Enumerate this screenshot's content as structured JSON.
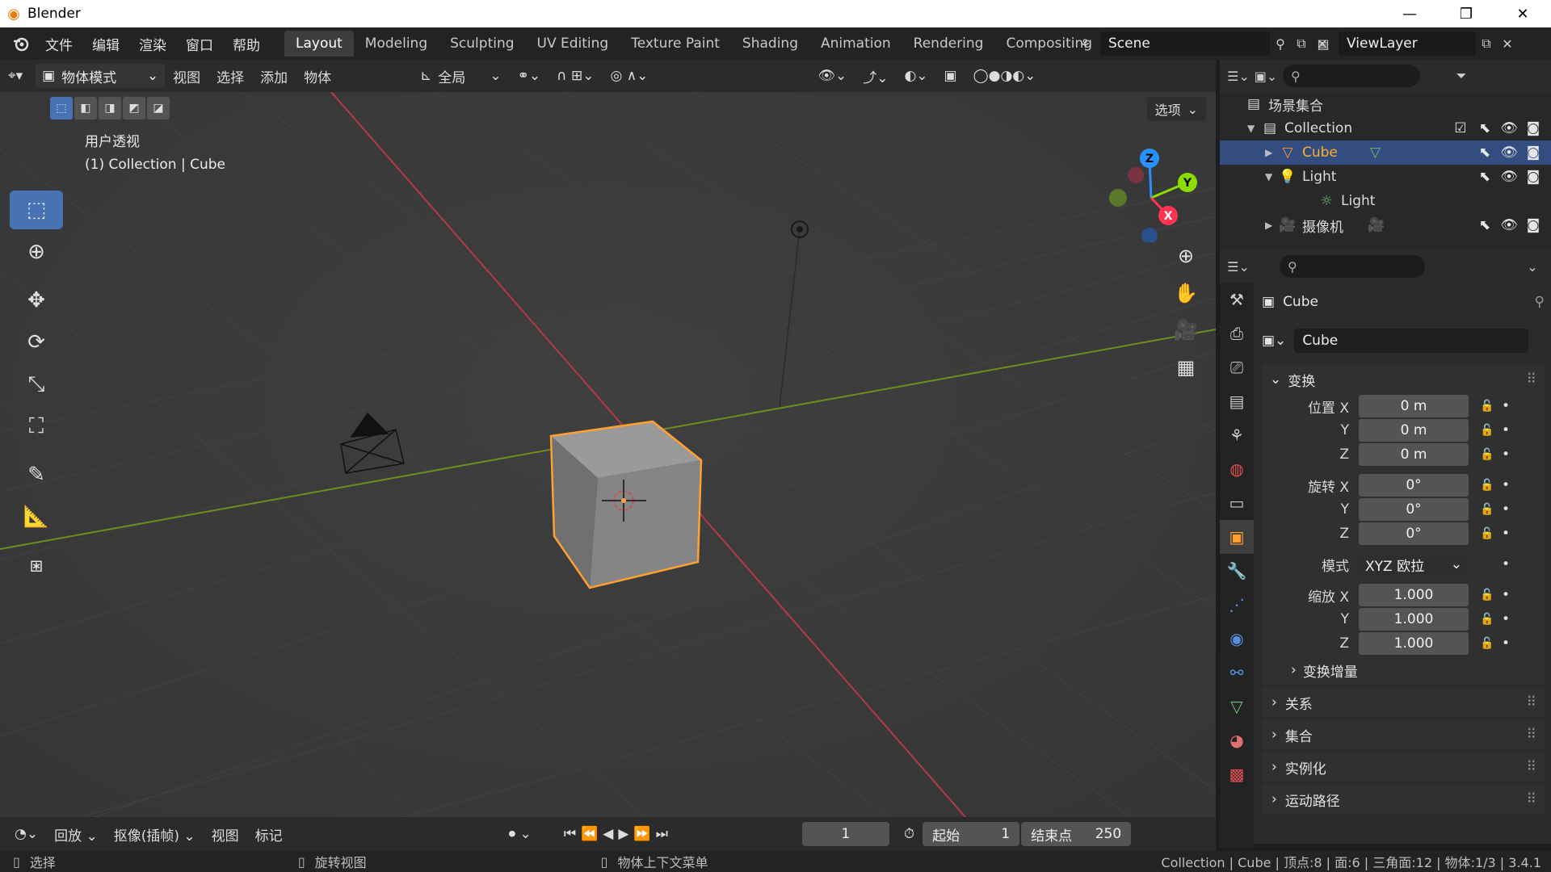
{
  "window": {
    "title": "Blender",
    "minimize": "—",
    "maximize": "❐",
    "close": "✕"
  },
  "menu": [
    "文件",
    "编辑",
    "渲染",
    "窗口",
    "帮助"
  ],
  "workspaces": [
    "Layout",
    "Modeling",
    "Sculpting",
    "UV Editing",
    "Texture Paint",
    "Shading",
    "Animation",
    "Rendering",
    "Compositing"
  ],
  "active_workspace": "Layout",
  "scene": {
    "name": "Scene",
    "view_layer": "ViewLayer"
  },
  "viewport": {
    "mode": "物体模式",
    "header_menus": [
      "视图",
      "选择",
      "添加",
      "物体"
    ],
    "transform_orientation": "全局",
    "options_label": "选项",
    "view_name": "用户透视",
    "collection_info": "(1) Collection | Cube",
    "gizmo": {
      "z": "Z",
      "y": "Y",
      "x": "X"
    }
  },
  "outliner": {
    "root": "场景集合",
    "rows": [
      {
        "label": "Collection",
        "depth": 1
      },
      {
        "label": "Cube",
        "depth": 2,
        "selected": true
      },
      {
        "label": "Light",
        "depth": 2
      },
      {
        "label": "Light",
        "depth": 3
      },
      {
        "label": "摄像机",
        "depth": 2
      }
    ]
  },
  "properties": {
    "object_name": "Cube",
    "data_name": "Cube",
    "transform_title": "变换",
    "location_label": "位置 X",
    "rotation_label": "旋转 X",
    "scale_label": "缩放 X",
    "y": "Y",
    "z": "Z",
    "location": [
      "0 m",
      "0 m",
      "0 m"
    ],
    "rotation": [
      "0°",
      "0°",
      "0°"
    ],
    "mode_label": "模式",
    "mode_value": "XYZ 欧拉",
    "scale": [
      "1.000",
      "1.000",
      "1.000"
    ],
    "delta_transform": "变换增量",
    "panels": [
      "关系",
      "集合",
      "实例化",
      "运动路径"
    ]
  },
  "timeline": {
    "playback": "回放",
    "keying": "抠像(插帧)",
    "view": "视图",
    "marker": "标记",
    "current_frame": "1",
    "start_label": "起始",
    "start_value": "1",
    "end_label": "结束点",
    "end_value": "250"
  },
  "status": {
    "left": "选择",
    "middle": "旋转视图",
    "right_menu": "物体上下文菜单",
    "stats": "Collection | Cube | 顶点:8 | 面:6 | 三角面:12 | 物体:1/3 | 3.4.1"
  },
  "colors": {
    "accent": "#4772b3",
    "selected_outline": "#ffa030",
    "x_axis": "#ff3352",
    "y_axis": "#8bdc00",
    "z_axis": "#2890ff"
  }
}
